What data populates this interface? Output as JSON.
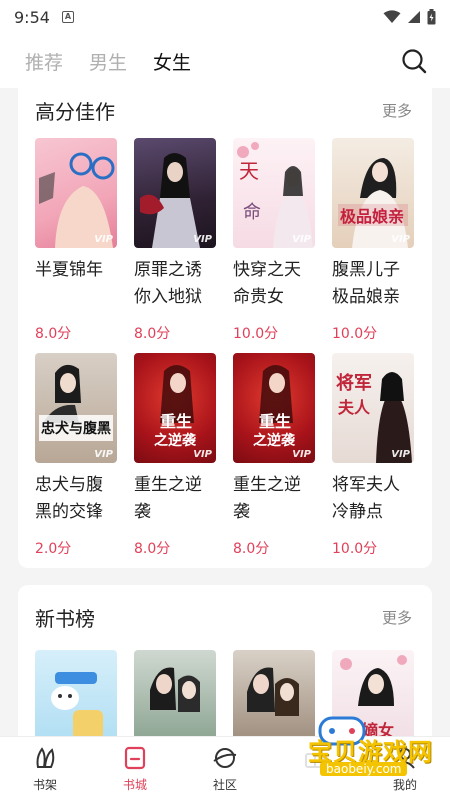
{
  "status": {
    "time": "9:54",
    "notif": "A"
  },
  "tabs": [
    {
      "label": "推荐",
      "active": false
    },
    {
      "label": "男生",
      "active": false
    },
    {
      "label": "女生",
      "active": true
    }
  ],
  "sections": [
    {
      "title": "高分佳作",
      "more": "更多",
      "books": [
        {
          "title": "半夏锦年",
          "score": "8.0分",
          "cover_color": "#f2b8c6"
        },
        {
          "title": "原罪之诱你入地狱",
          "score": "8.0分",
          "cover_color": "#3a2a44"
        },
        {
          "title": "快穿之天命贵女",
          "score": "10.0分",
          "cover_color": "#f6e3ea"
        },
        {
          "title": "腹黑儿子极品娘亲",
          "score": "10.0分",
          "cover_color": "#e8d7c5"
        },
        {
          "title": "忠犬与腹黑的交锋",
          "score": "2.0分",
          "cover_color": "#cfc1b3"
        },
        {
          "title": "重生之逆袭",
          "score": "8.0分",
          "cover_color": "#b51d1d"
        },
        {
          "title": "重生之逆袭",
          "score": "8.0分",
          "cover_color": "#b51d1d"
        },
        {
          "title": "将军夫人冷静点",
          "score": "10.0分",
          "cover_color": "#ece4e0"
        }
      ]
    },
    {
      "title": "新书榜",
      "more": "更多",
      "books": [
        {
          "cover_color": "#bfe3f4"
        },
        {
          "cover_color": "#6e8a74"
        },
        {
          "cover_color": "#8a7a6c"
        },
        {
          "cover_color": "#f3e6ea"
        }
      ]
    }
  ],
  "nav": [
    {
      "label": "书架",
      "icon": "bookshelf-icon",
      "active": false
    },
    {
      "label": "书城",
      "icon": "bookstore-icon",
      "active": true
    },
    {
      "label": "社区",
      "icon": "community-icon",
      "active": false
    },
    {
      "label": "",
      "icon": "welfare-icon",
      "active": false
    },
    {
      "label": "我的",
      "icon": "profile-icon",
      "active": false
    }
  ],
  "watermark": {
    "text": "宝贝游戏网",
    "url": "baobeiy.com"
  },
  "colors": {
    "accent": "#e0415a",
    "background": "#f4f4f4"
  }
}
